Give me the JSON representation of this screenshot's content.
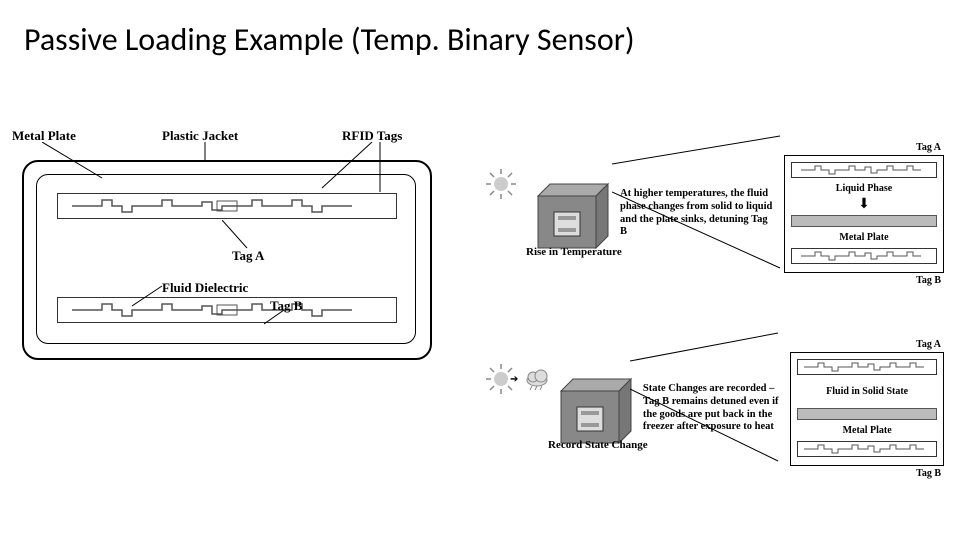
{
  "title": "Passive Loading Example (Temp. Binary Sensor)",
  "left": {
    "metal_plate": "Metal Plate",
    "plastic_jacket": "Plastic Jacket",
    "rfid_tags": "RFID Tags",
    "tag_a": "Tag A",
    "fluid_dielectric": "Fluid Dielectric",
    "tag_b": "Tag B"
  },
  "right": {
    "scenarioTop": {
      "text": "At higher temperatures, the fluid phase changes from solid to liquid and the plate sinks,  detuning Tag B",
      "caption": "Rise in Temperature",
      "box": {
        "tagA": "Tag A",
        "tagB": "Tag B",
        "liquid": "Liquid Phase",
        "metal": "Metal Plate"
      }
    },
    "scenarioBot": {
      "text": "State Changes are recorded – Tag B remains detuned even  if the goods are put back in the freezer after exposure to heat",
      "caption": "Record State Change",
      "box": {
        "tagA": "Tag A",
        "tagB": "Tag B",
        "fluid": "Fluid in Solid State",
        "metal": "Metal Plate"
      }
    }
  }
}
